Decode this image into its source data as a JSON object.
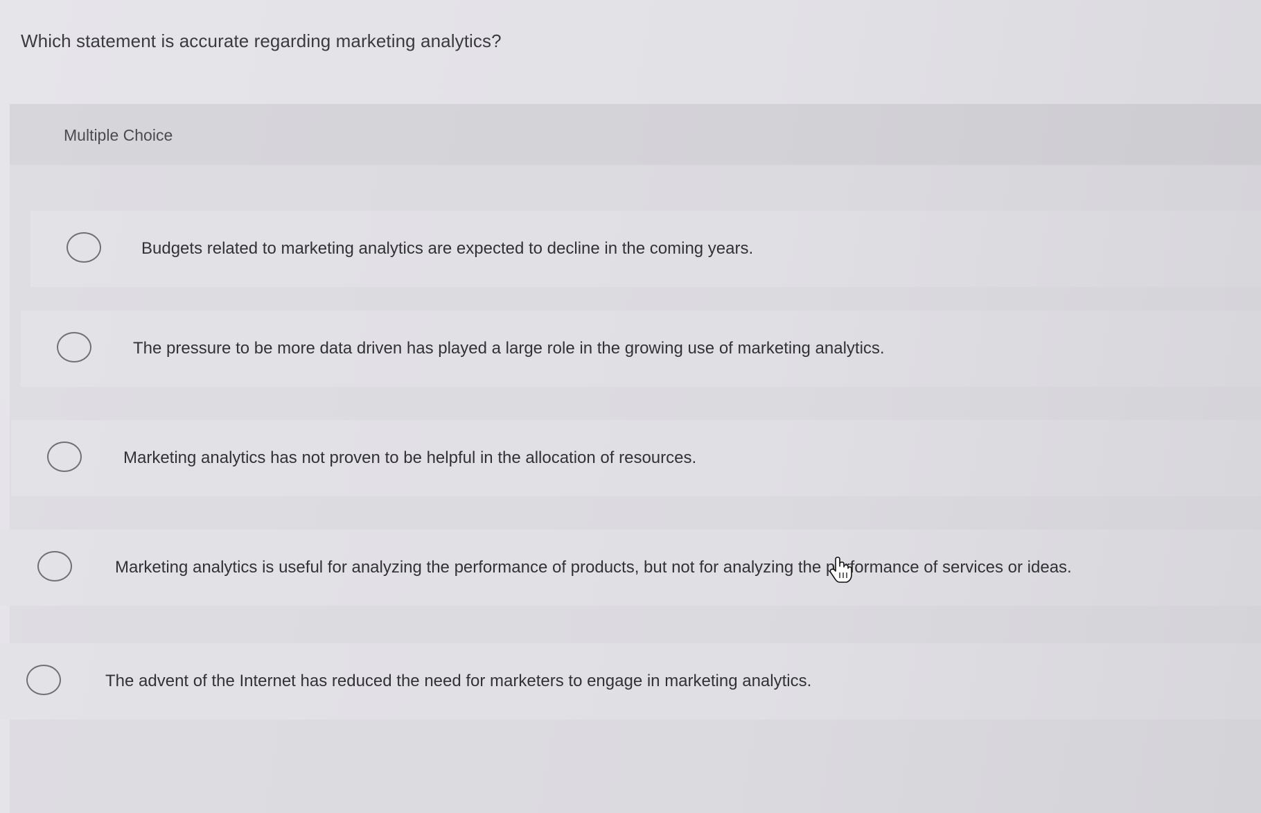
{
  "question": "Which statement is accurate regarding marketing analytics?",
  "question_type": "Multiple Choice",
  "options": [
    {
      "label": "Budgets related to marketing analytics are expected to decline in the coming years."
    },
    {
      "label": "The pressure to be more data driven has played a large role in the growing use of marketing analytics."
    },
    {
      "label": "Marketing analytics has not proven to be helpful in the allocation of resources."
    },
    {
      "label": "Marketing analytics is useful for analyzing the performance of products, but not for analyzing the performance of services or ideas."
    },
    {
      "label": "The advent of the Internet has reduced the need for marketers to engage in marketing analytics."
    }
  ],
  "colors": {
    "background": "#e4e3e8",
    "panel": "#dcdbe0",
    "option": "#e2e1e6",
    "text": "#323236",
    "radio_border": "#6f6f75"
  },
  "icons": [
    "radio-unselected-icon",
    "hand-pointer-cursor-icon"
  ]
}
